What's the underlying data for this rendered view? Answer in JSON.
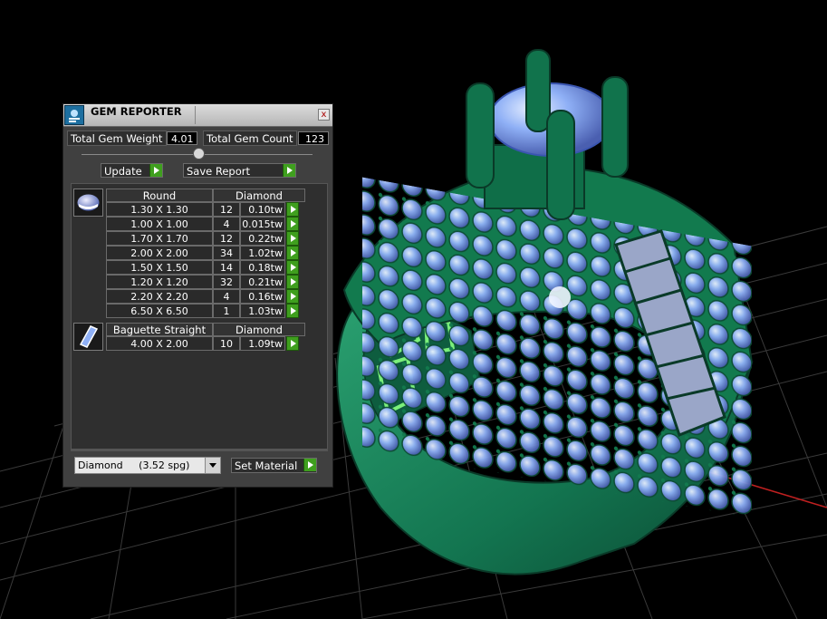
{
  "window": {
    "title": "GEM REPORTER",
    "close_label": "x"
  },
  "summary": {
    "weight_label": "Total Gem Weight",
    "weight_value": "4.01",
    "count_label": "Total Gem Count",
    "count_value": "123"
  },
  "toolbar": {
    "update_label": "Update",
    "save_label": "Save Report"
  },
  "groups": [
    {
      "shape": "Round",
      "material": "Diamond",
      "rows": [
        {
          "size": "1.30 X 1.30",
          "count": "12",
          "weight": "0.10tw"
        },
        {
          "size": "1.00 X 1.00",
          "count": "4",
          "weight": "0.015tw"
        },
        {
          "size": "1.70 X 1.70",
          "count": "12",
          "weight": "0.22tw"
        },
        {
          "size": "2.00 X 2.00",
          "count": "34",
          "weight": "1.02tw"
        },
        {
          "size": "1.50 X 1.50",
          "count": "14",
          "weight": "0.18tw"
        },
        {
          "size": "1.20 X 1.20",
          "count": "32",
          "weight": "0.21tw"
        },
        {
          "size": "2.20 X 2.20",
          "count": "4",
          "weight": "0.16tw"
        },
        {
          "size": "6.50 X 6.50",
          "count": "1",
          "weight": "1.03tw"
        }
      ]
    },
    {
      "shape": "Baguette Straight",
      "material": "Diamond",
      "rows": [
        {
          "size": "4.00 X 2.00",
          "count": "10",
          "weight": "1.09tw"
        }
      ]
    }
  ],
  "material": {
    "selected": "Diamond     (3.52 spg)",
    "set_label": "Set Material"
  },
  "colors": {
    "ring": "#1e8a5a",
    "gem": "#8fb4ff",
    "grid": "#3a3a3a",
    "accent": "#3f9f1e"
  }
}
